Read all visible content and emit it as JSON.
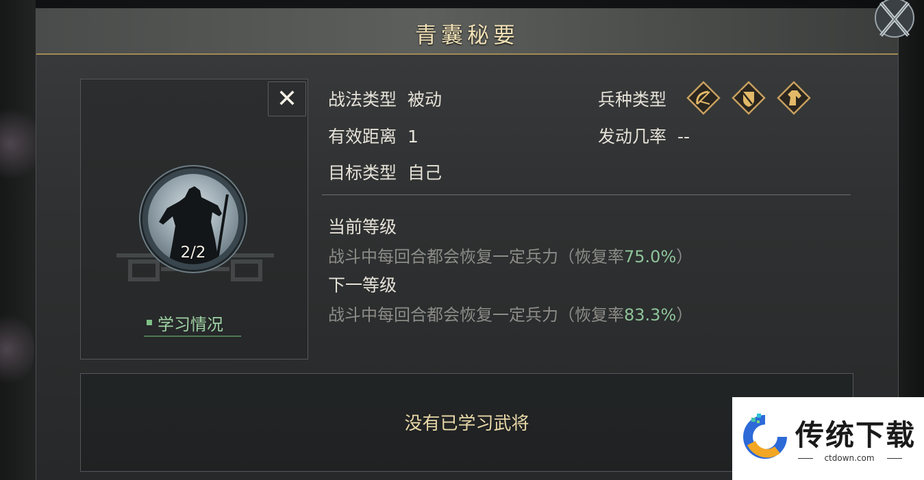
{
  "title": "青囊秘要",
  "skill": {
    "level": "2/2",
    "study_tab": "学习情况"
  },
  "info": {
    "tactic_type": {
      "label": "战法类型",
      "value": "被动"
    },
    "range": {
      "label": "有效距离",
      "value": "1"
    },
    "target_type": {
      "label": "目标类型",
      "value": "自己"
    },
    "unit_type": {
      "label": "兵种类型",
      "icons": [
        "bow-unit-icon",
        "shield-unit-icon",
        "cavalry-unit-icon"
      ]
    },
    "trigger_rate": {
      "label": "发动几率",
      "value": "--"
    }
  },
  "current_level": {
    "heading": "当前等级",
    "description": "战斗中每回合都会恢复一定兵力（恢复率",
    "rate": "75.0%",
    "close": "）"
  },
  "next_level": {
    "heading": "下一等级",
    "description": "战斗中每回合都会恢复一定兵力（恢复率",
    "rate": "83.3%",
    "close": "）"
  },
  "learned": {
    "empty_text": "没有已学习武将"
  },
  "watermark": {
    "name": "传统下载",
    "url": "ctdown.com"
  },
  "colors": {
    "accent_gold": "#a38a55",
    "title_gold": "#efe0b6",
    "rate_green": "#8fc49a",
    "tab_green": "#9fd2a3"
  }
}
